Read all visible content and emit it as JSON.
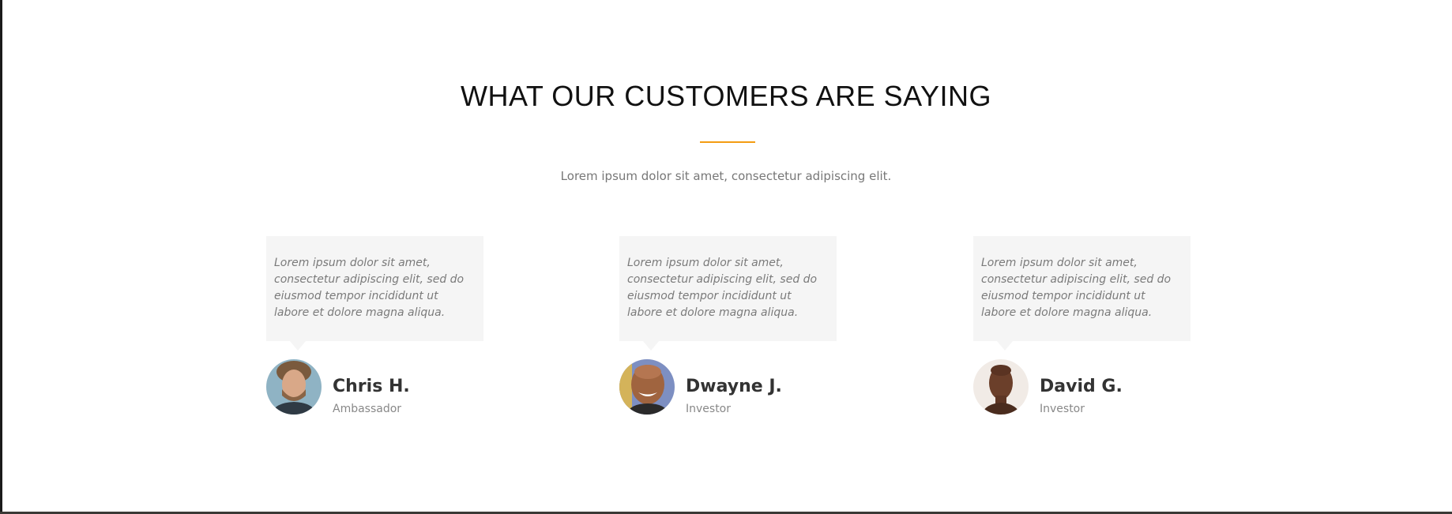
{
  "section": {
    "heading": "WHAT OUR CUSTOMERS ARE SAYING",
    "subtitle": "Lorem ipsum dolor sit amet, consectetur adipiscing elit.",
    "accent_color": "#f39c12"
  },
  "testimonials": [
    {
      "quote": "Lorem ipsum dolor sit amet, consectetur adipiscing elit, sed do eiusmod tempor incididunt ut labore et dolore magna aliqua.",
      "name": "Chris H.",
      "role": "Ambassador"
    },
    {
      "quote": "Lorem ipsum dolor sit amet, consectetur adipiscing elit, sed do eiusmod tempor incididunt ut labore et dolore magna aliqua.",
      "name": "Dwayne J.",
      "role": "Investor"
    },
    {
      "quote": "Lorem ipsum dolor sit amet, consectetur adipiscing elit, sed do eiusmod tempor incididunt ut labore et dolore magna aliqua.",
      "name": "David G.",
      "role": "Investor"
    }
  ]
}
